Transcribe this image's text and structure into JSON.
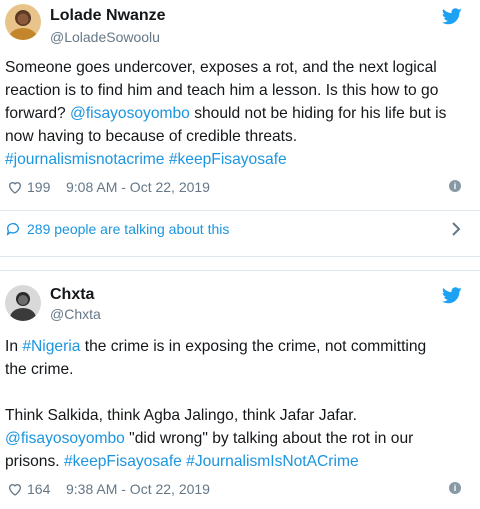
{
  "tweets": [
    {
      "name": "Lolade Nwanze",
      "handle": "@LoladeSowoolu",
      "lines": [
        [
          {
            "t": "Someone goes undercover, exposes a rot, and the next logical"
          }
        ],
        [
          {
            "t": "reaction is to find him and teach him a lesson. Is this how to go"
          }
        ],
        [
          {
            "t": "forward? "
          },
          {
            "t": "@fisayosoyombo",
            "link": true
          },
          {
            "t": " should not be hiding for his life but is"
          }
        ],
        [
          {
            "t": "now having to because of credible threats."
          }
        ],
        [
          {
            "t": "#journalismisnotacrime",
            "link": true
          },
          {
            "t": " "
          },
          {
            "t": "#keepFisayosafe",
            "link": true
          }
        ]
      ],
      "likes": "199",
      "time": "9:08 AM - Oct 22, 2019",
      "talking": "289 people are talking about this"
    },
    {
      "name": "Chxta",
      "handle": "@Chxta",
      "lines": [
        [
          {
            "t": "In "
          },
          {
            "t": "#Nigeria",
            "link": true
          },
          {
            "t": " the crime is in exposing the crime, not committing"
          }
        ],
        [
          {
            "t": "the crime."
          }
        ],
        [
          {
            "t": ""
          }
        ],
        [
          {
            "t": "Think Salkida, think Agba Jalingo, think Jafar Jafar."
          }
        ],
        [
          {
            "t": "@fisayosoyombo",
            "link": true
          },
          {
            "t": " \"did wrong\" by talking about the rot in our"
          }
        ],
        [
          {
            "t": "prisons. "
          },
          {
            "t": "#keepFisayosafe",
            "link": true
          },
          {
            "t": " "
          },
          {
            "t": "#JournalismIsNotACrime",
            "link": true
          }
        ]
      ],
      "likes": "164",
      "time": "9:38 AM - Oct 22, 2019"
    }
  ],
  "icons": {
    "platform": "twitter-bird-icon",
    "like": "heart-icon",
    "info": "info-icon",
    "reply": "speech-bubble-icon",
    "more": "chevron-right-icon"
  },
  "colors": {
    "link": "#1b95e0",
    "text": "#14171a",
    "muted": "#657786",
    "divider": "#e1e8ed"
  }
}
